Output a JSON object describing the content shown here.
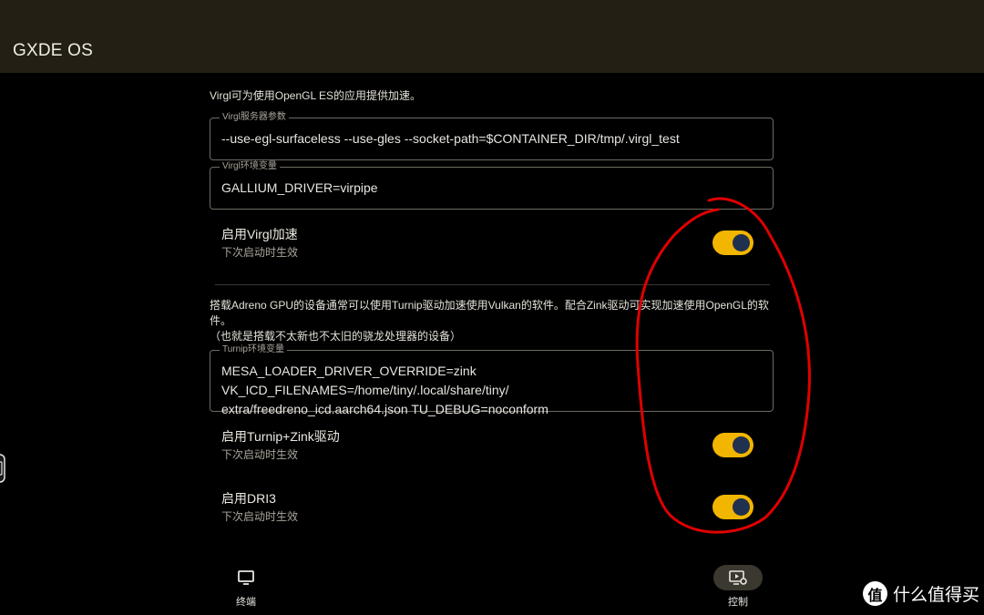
{
  "app": {
    "title": "GXDE OS"
  },
  "virgl": {
    "description": "Virgl可为使用OpenGL ES的应用提供加速。",
    "server_args": {
      "label": "Virgl服务器参数",
      "value": "--use-egl-surfaceless --use-gles --socket-path=$CONTAINER_DIR/tmp/.virgl_test"
    },
    "env": {
      "label": "Virgl环境变量",
      "value": "GALLIUM_DRIVER=virpipe"
    },
    "enable": {
      "title": "启用Virgl加速",
      "subtitle": "下次启动时生效",
      "on": true
    }
  },
  "turnip": {
    "description_line1": "搭载Adreno GPU的设备通常可以使用Turnip驱动加速使用Vulkan的软件。配合Zink驱动可实现加速使用OpenGL的软",
    "description_line2": "件。",
    "description_line3": "（也就是搭载不太新也不太旧的骁龙处理器的设备）",
    "env": {
      "label": "Turnip环境变量",
      "value_line1": "MESA_LOADER_DRIVER_OVERRIDE=zink VK_ICD_FILENAMES=/home/tiny/.local/share/tiny/",
      "value_line2": "extra/freedreno_icd.aarch64.json TU_DEBUG=noconform"
    },
    "enable": {
      "title": "启用Turnip+Zink驱动",
      "subtitle": "下次启动时生效",
      "on": true
    }
  },
  "dri3": {
    "title": "启用DRI3",
    "subtitle": "下次启动时生效",
    "on": true
  },
  "bottom_nav": {
    "items": [
      {
        "label": "终端",
        "icon": "monitor-icon",
        "active": false
      },
      {
        "label": "控制",
        "icon": "display-settings-icon",
        "active": true
      }
    ]
  },
  "watermark": {
    "badge": "值",
    "text": "什么值得买"
  },
  "colors": {
    "toggle_track": "#f2b500",
    "toggle_knob": "#20304f",
    "appbar": "#231f14",
    "annotation": "#e00000"
  }
}
